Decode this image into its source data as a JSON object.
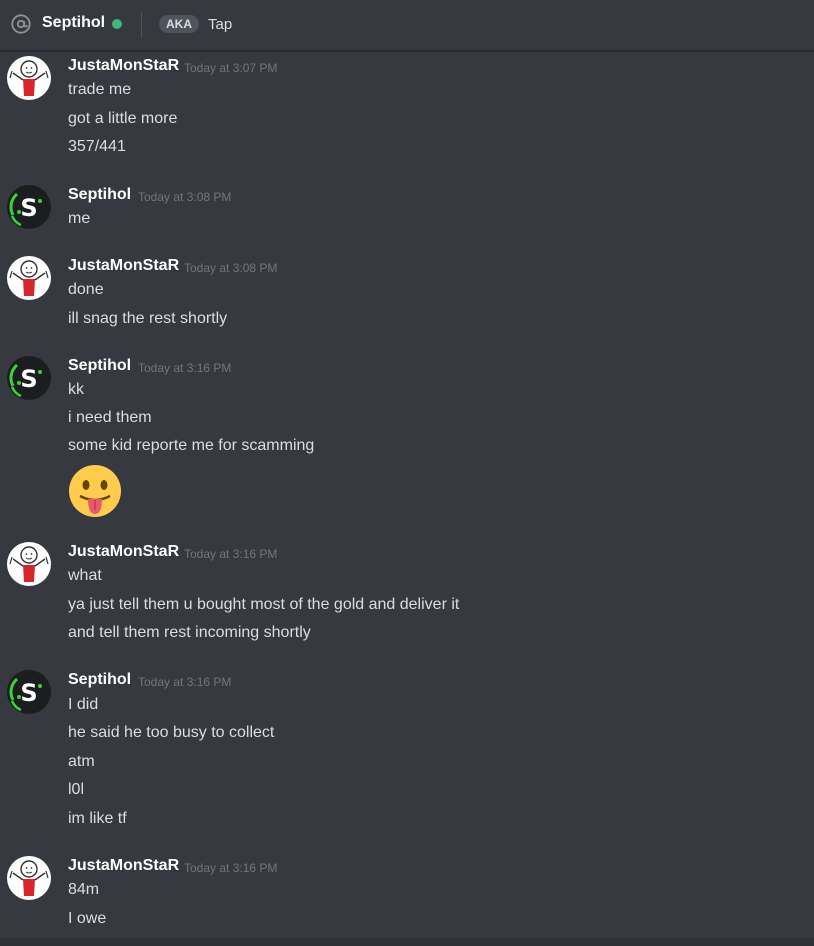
{
  "header": {
    "channel_icon": "at-sign-icon",
    "username": "Septihol",
    "status": "online",
    "status_color": "#43b581",
    "aka_badge": "AKA",
    "aka_name": "Tap"
  },
  "colors": {
    "background": "#36393f",
    "text": "#dcddde",
    "username": "#ffffff",
    "timestamp": "#72767d"
  },
  "messages": [
    {
      "author": "JustaMonStaR",
      "avatar": "stickman-avatar",
      "time": "Today at 3:07 PM",
      "lines": [
        "trade me",
        "got a little more",
        "357/441"
      ]
    },
    {
      "author": "Septihol",
      "avatar": "s-logo-avatar",
      "time": "Today at 3:08 PM",
      "lines": [
        "me"
      ]
    },
    {
      "author": "JustaMonStaR",
      "avatar": "stickman-avatar",
      "time": "Today at 3:08 PM",
      "lines": [
        "done",
        "ill snag the rest shortly"
      ]
    },
    {
      "author": "Septihol",
      "avatar": "s-logo-avatar",
      "time": "Today at 3:16 PM",
      "lines": [
        "kk",
        "i need them",
        "some kid reporte me for scamming"
      ],
      "emoji": "tongue-out-face-emoji"
    },
    {
      "author": "JustaMonStaR",
      "avatar": "stickman-avatar",
      "time": "Today at 3:16 PM",
      "lines": [
        "what",
        "ya just tell them u bought most of the gold and deliver it",
        "and tell them rest incoming shortly"
      ]
    },
    {
      "author": "Septihol",
      "avatar": "s-logo-avatar",
      "time": "Today at 3:16 PM",
      "lines": [
        "I did",
        "he said he too busy to collect",
        "atm",
        "l0l",
        "im like tf"
      ]
    },
    {
      "author": "JustaMonStaR",
      "avatar": "stickman-avatar",
      "time": "Today at 3:16 PM",
      "lines": [
        "84m",
        "I owe"
      ]
    }
  ]
}
